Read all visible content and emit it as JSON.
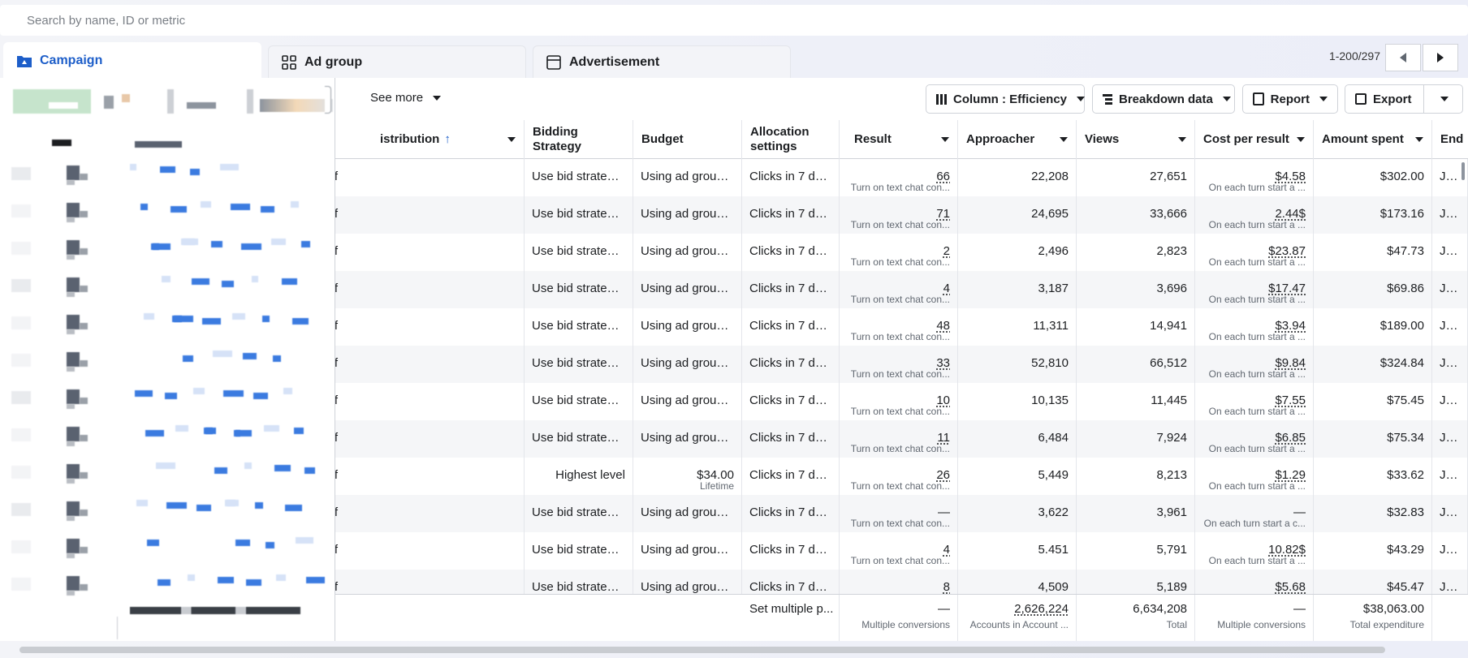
{
  "search": {
    "placeholder": "Search by name, ID or metric"
  },
  "tabs": [
    {
      "label": "Campaign",
      "icon": "folder-icon",
      "active": true
    },
    {
      "label": "Ad group",
      "icon": "grid-icon",
      "active": false
    },
    {
      "label": "Advertisement",
      "icon": "ad-frame-icon",
      "active": false
    }
  ],
  "pagination": {
    "range": "1-200/297"
  },
  "toolbar": {
    "see_more": "See more",
    "column_label": "Column : Efficiency",
    "breakdown_label": "Breakdown data",
    "report_label": "Report",
    "export_label": "Export"
  },
  "columns": {
    "distribution": "istribution",
    "bidding": "Bidding Strategy",
    "budget": "Budget",
    "allocation": "Allocation settings",
    "result": "Result",
    "approacher": "Approacher",
    "views": "Views",
    "cpr": "Cost per result",
    "spent": "Amount spent",
    "end": "End"
  },
  "rows": [
    {
      "dist": "ff",
      "bid": "Use bid strategi...",
      "budget": "Using ad group ...",
      "budget_sub": "",
      "alloc": "Clicks in 7 day...",
      "result": "66",
      "result_sub": "Turn on text chat con...",
      "approacher": "22,208",
      "views": "27,651",
      "cpr": "$4.58",
      "cpr_sub": "On each turn start a ...",
      "spent": "$302.00",
      "end": "Janu"
    },
    {
      "dist": "ff",
      "bid": "Use bid strategi...",
      "budget": "Using ad group ...",
      "budget_sub": "",
      "alloc": "Clicks in 7 day...",
      "result": "71",
      "result_sub": "Turn on text chat con...",
      "approacher": "24,695",
      "views": "33,666",
      "cpr": "2.44$",
      "cpr_sub": "On each turn start a ...",
      "spent": "$173.16",
      "end": "Janu"
    },
    {
      "dist": "ff",
      "bid": "Use bid strategi...",
      "budget": "Using ad group ...",
      "budget_sub": "",
      "alloc": "Clicks in 7 day...",
      "result": "2",
      "result_sub": "Turn on text chat con...",
      "approacher": "2,496",
      "views": "2,823",
      "cpr": "$23.87",
      "cpr_sub": "On each turn start a ...",
      "spent": "$47.73",
      "end": "Janu"
    },
    {
      "dist": "ff",
      "bid": "Use bid strategi...",
      "budget": "Using ad group ...",
      "budget_sub": "",
      "alloc": "Clicks in 7 day...",
      "result": "4",
      "result_sub": "Turn on text chat con...",
      "approacher": "3,187",
      "views": "3,696",
      "cpr": "$17.47",
      "cpr_sub": "On each turn start a ...",
      "spent": "$69.86",
      "end": "Janu"
    },
    {
      "dist": "ff",
      "bid": "Use bid strategi...",
      "budget": "Using ad group ...",
      "budget_sub": "",
      "alloc": "Clicks in 7 day...",
      "result": "48",
      "result_sub": "Turn on text chat con...",
      "approacher": "11,311",
      "views": "14,941",
      "cpr": "$3.94",
      "cpr_sub": "On each turn start a ...",
      "spent": "$189.00",
      "end": "Janu"
    },
    {
      "dist": "ff",
      "bid": "Use bid strategi...",
      "budget": "Using ad group ...",
      "budget_sub": "",
      "alloc": "Clicks in 7 day...",
      "result": "33",
      "result_sub": "Turn on text chat con...",
      "approacher": "52,810",
      "views": "66,512",
      "cpr": "$9.84",
      "cpr_sub": "On each turn start a ...",
      "spent": "$324.84",
      "end": "Janu"
    },
    {
      "dist": "ff",
      "bid": "Use bid strategi...",
      "budget": "Using ad group ...",
      "budget_sub": "",
      "alloc": "Clicks in 7 day...",
      "result": "10",
      "result_sub": "Turn on text chat con...",
      "approacher": "10,135",
      "views": "11,445",
      "cpr": "$7.55",
      "cpr_sub": "On each turn start a ...",
      "spent": "$75.45",
      "end": "Janu"
    },
    {
      "dist": "ff",
      "bid": "Use bid strategi...",
      "budget": "Using ad group ...",
      "budget_sub": "",
      "alloc": "Clicks in 7 day...",
      "result": "11",
      "result_sub": "Turn on text chat con...",
      "approacher": "6,484",
      "views": "7,924",
      "cpr": "$6.85",
      "cpr_sub": "On each turn start a ...",
      "spent": "$75.34",
      "end": "Janu"
    },
    {
      "dist": "ff",
      "bid": "Highest level",
      "budget": "$34.00",
      "budget_sub": "Lifetime",
      "alloc": "Clicks in 7 day...",
      "result": "26",
      "result_sub": "Turn on text chat con...",
      "approacher": "5,449",
      "views": "8,213",
      "cpr": "$1.29",
      "cpr_sub": "On each turn start a ...",
      "spent": "$33.62",
      "end": "Janu"
    },
    {
      "dist": "ff",
      "bid": "Use bid strategi...",
      "budget": "Using ad group ...",
      "budget_sub": "",
      "alloc": "Clicks in 7 day...",
      "result": "—",
      "result_sub": "Turn on text chat con...",
      "approacher": "3,622",
      "views": "3,961",
      "cpr": "—",
      "cpr_sub": "On each turn start a c...",
      "spent": "$32.83",
      "end": "Janu"
    },
    {
      "dist": "ff",
      "bid": "Use bid strategi...",
      "budget": "Using ad group ...",
      "budget_sub": "",
      "alloc": "Clicks in 7 day...",
      "result": "4",
      "result_sub": "Turn on text chat con...",
      "approacher": "5.451",
      "views": "5,791",
      "cpr": "10.82$",
      "cpr_sub": "On each turn start a ...",
      "spent": "$43.29",
      "end": "Janu"
    },
    {
      "dist": "ff",
      "bid": "Use bid strategi...",
      "budget": "Using ad group ...",
      "budget_sub": "",
      "alloc": "Clicks in 7 day...",
      "result": "8",
      "result_sub": "",
      "approacher": "4,509",
      "views": "5,189",
      "cpr": "$5.68",
      "cpr_sub": "",
      "spent": "$45.47",
      "end": "Janu"
    }
  ],
  "totals": {
    "alloc": "Set multiple p...",
    "result": "—",
    "result_sub": "Multiple conversions",
    "approacher": "2,626,224",
    "approacher_sub": "Accounts in Account ...",
    "views": "6,634,208",
    "views_sub": "Total",
    "cpr": "—",
    "cpr_sub": "Multiple conversions",
    "spent": "$38,063.00",
    "spent_sub": "Total expenditure"
  },
  "colors": {
    "accent": "#1d5ec9",
    "blur_blue": "#3b7be0",
    "blur_gray": "#5a6270"
  }
}
